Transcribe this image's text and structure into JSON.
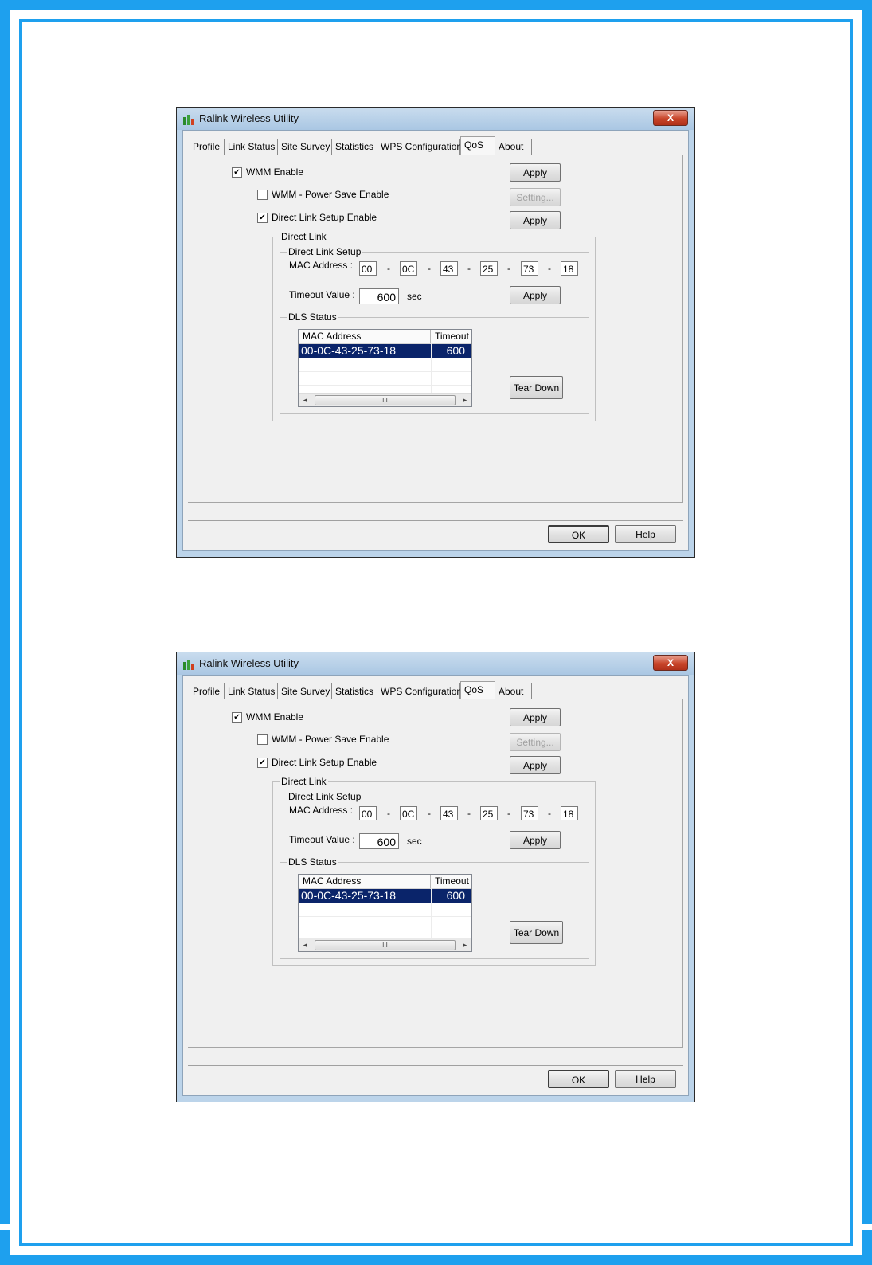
{
  "dialogs": [
    {
      "title": "Ralink Wireless Utility",
      "close_label": "X",
      "tabs": [
        "Profile",
        "Link Status",
        "Site Survey",
        "Statistics",
        "WPS Configuration",
        "QoS",
        "About"
      ],
      "active_tab": "QoS",
      "wmm_enable": {
        "label": "WMM Enable",
        "checked": true,
        "apply_label": "Apply"
      },
      "wmm_power_save": {
        "label": "WMM - Power Save Enable",
        "checked": false,
        "setting_label": "Setting..."
      },
      "direct_link_setup_enable": {
        "label": "Direct Link Setup Enable",
        "checked": true,
        "apply_label": "Apply"
      },
      "direct_link": {
        "group_label": "Direct Link",
        "setup_group_label": "Direct Link Setup",
        "mac_label": "MAC Address :",
        "mac_octets": [
          "00",
          "0C",
          "43",
          "25",
          "73",
          "18"
        ],
        "mac_separator": "-",
        "timeout_label": "Timeout Value :",
        "timeout_value": "600",
        "timeout_unit": "sec",
        "apply_label": "Apply"
      },
      "dls_status": {
        "group_label": "DLS Status",
        "columns": [
          "MAC Address",
          "Timeout"
        ],
        "rows": [
          [
            "00-0C-43-25-73-18",
            "600"
          ]
        ],
        "scroll_grip": "III",
        "scroll_left": "◂",
        "scroll_right": "▸",
        "tear_down_label": "Tear Down"
      },
      "ok_label": "OK",
      "help_label": "Help"
    },
    {
      "title": "Ralink Wireless Utility",
      "close_label": "X",
      "tabs": [
        "Profile",
        "Link Status",
        "Site Survey",
        "Statistics",
        "WPS Configuration",
        "QoS",
        "About"
      ],
      "active_tab": "QoS",
      "wmm_enable": {
        "label": "WMM Enable",
        "checked": true,
        "apply_label": "Apply"
      },
      "wmm_power_save": {
        "label": "WMM - Power Save Enable",
        "checked": false,
        "setting_label": "Setting..."
      },
      "direct_link_setup_enable": {
        "label": "Direct Link Setup Enable",
        "checked": true,
        "apply_label": "Apply"
      },
      "direct_link": {
        "group_label": "Direct Link",
        "setup_group_label": "Direct Link Setup",
        "mac_label": "MAC Address :",
        "mac_octets": [
          "00",
          "0C",
          "43",
          "25",
          "73",
          "18"
        ],
        "mac_separator": "-",
        "timeout_label": "Timeout Value :",
        "timeout_value": "600",
        "timeout_unit": "sec",
        "apply_label": "Apply"
      },
      "dls_status": {
        "group_label": "DLS Status",
        "columns": [
          "MAC Address",
          "Timeout"
        ],
        "rows": [
          [
            "00-0C-43-25-73-18",
            "600"
          ]
        ],
        "scroll_grip": "III",
        "scroll_left": "◂",
        "scroll_right": "▸",
        "tear_down_label": "Tear Down"
      },
      "ok_label": "OK",
      "help_label": "Help"
    }
  ],
  "colors": {
    "frame": "#1ea0ee",
    "selection": "#0a246a",
    "titlebar": "#bcd4ea"
  }
}
